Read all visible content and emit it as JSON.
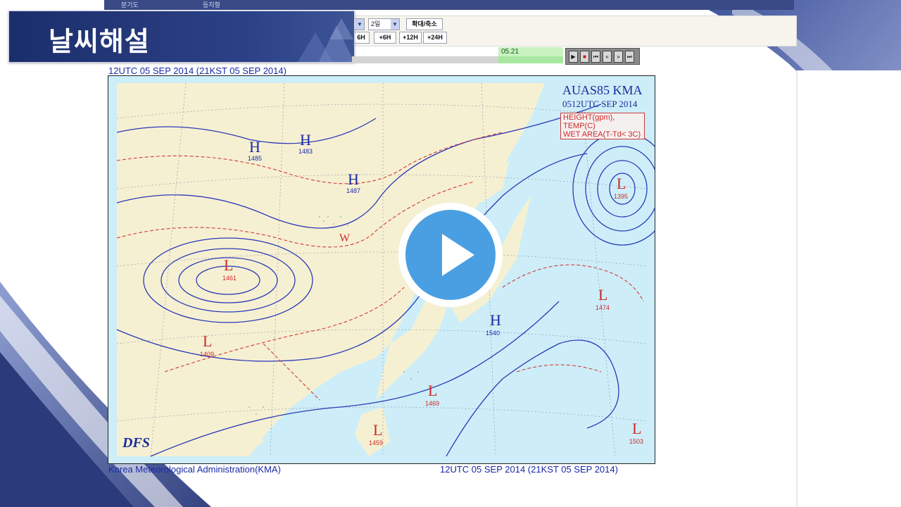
{
  "page": {
    "title": "날씨해설"
  },
  "top_strip": {
    "tab1": "분기도",
    "tab2": "등지형"
  },
  "toolbar": {
    "select1_value": "",
    "select2_value": "2일",
    "zoom_button": "확대/축소",
    "step_buttons": [
      "6H",
      "6H",
      "12H",
      "24H"
    ],
    "step_prefix_back": "-",
    "step_prefix_fwd": "+"
  },
  "timeline": {
    "current_label": "05.21",
    "progress_fraction": 0.7
  },
  "player_controls": [
    "play",
    "stop",
    "first",
    "prev",
    "next",
    "last"
  ],
  "map": {
    "header_time": "12UTC 05 SEP 2014 (21KST 05 SEP 2014)",
    "legend_title": "AUAS85 KMA",
    "legend_time": "0512UTC SEP 2014",
    "legend_line1": "HEIGHT(gpm), TEMP(C)",
    "legend_line2": "WET AREA(T-Td< 3C)",
    "logo": "DFS",
    "footer_left": "Korea Meteorological Administration(KMA)",
    "footer_right": "12UTC 05 SEP 2014 (21KST 05 SEP 2014)",
    "pressure_systems": [
      {
        "type": "H",
        "value": "1485"
      },
      {
        "type": "H",
        "value": "1483"
      },
      {
        "type": "H",
        "value": "1487"
      },
      {
        "type": "L",
        "value": "1461"
      },
      {
        "type": "L",
        "value": "1409"
      },
      {
        "type": "W",
        "value": ""
      },
      {
        "type": "H",
        "value": "1540"
      },
      {
        "type": "L",
        "value": "1474"
      },
      {
        "type": "L",
        "value": "1469"
      },
      {
        "type": "L",
        "value": "1459"
      },
      {
        "type": "L",
        "value": "1503"
      },
      {
        "type": "L",
        "value": "1395"
      }
    ]
  },
  "colors": {
    "title_bg": "#1b2e6b",
    "play_button": "#4a9fe2",
    "high": "#1a2aa8",
    "low": "#cc2a2a"
  }
}
